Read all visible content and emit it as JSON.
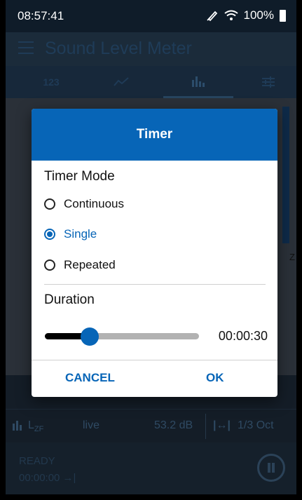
{
  "status_bar": {
    "time": "08:57:41",
    "battery": "100%"
  },
  "app": {
    "title": "Sound Level Meter",
    "tabs": [
      {
        "label": "123"
      },
      {
        "label": ""
      },
      {
        "label": ""
      },
      {
        "label": ""
      }
    ],
    "bottom_row": {
      "weighting": "L",
      "weighting_sub": "ZF",
      "mode": "live",
      "level": "53.2 dB",
      "band": "1/3 Oct"
    },
    "status": {
      "state": "READY",
      "elapsed": "00:00:00 →|"
    }
  },
  "dialog": {
    "title": "Timer",
    "mode_label": "Timer Mode",
    "options": [
      {
        "label": "Continuous",
        "selected": false
      },
      {
        "label": "Single",
        "selected": true
      },
      {
        "label": "Repeated",
        "selected": false
      }
    ],
    "duration_label": "Duration",
    "slider_fraction": 0.29,
    "duration_value": "00:00:30",
    "cancel_label": "CANCEL",
    "ok_label": "OK"
  },
  "colors": {
    "accent": "#0765b7",
    "header": "#0765b7"
  }
}
